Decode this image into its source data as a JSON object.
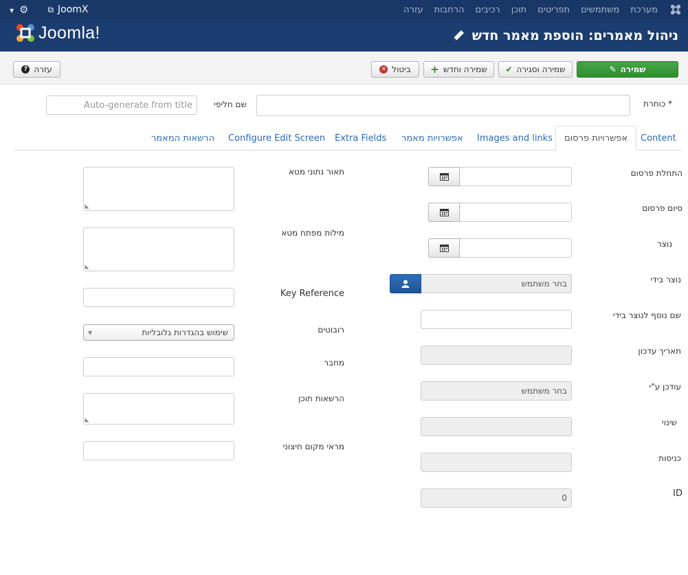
{
  "topnav": {
    "menu": [
      "מערכת",
      "משתמשים",
      "תפריטים",
      "תוכן",
      "רכיבים",
      "הרחבות",
      "עזרה"
    ],
    "site_name": "JoomX"
  },
  "header": {
    "logo_text": "Joomla!",
    "page_title": "ניהול מאמרים: הוספת מאמר חדש"
  },
  "toolbar": {
    "save": "שמירה",
    "save_close": "שמירה וסגירה",
    "save_new": "שמירה וחדש",
    "cancel": "ביטול",
    "help": "עזרה"
  },
  "title_row": {
    "title_label": "כותרת *",
    "alias_label": "שם חליפי",
    "alias_placeholder": "Auto-generate from title"
  },
  "tabs": [
    "Content",
    "אפשרויות פרסום",
    "Images and links",
    "אפשרויות מאמר",
    "Extra Fields",
    "Configure Edit Screen",
    "הרשאות המאמר"
  ],
  "publishing": {
    "publish_up": "התחלת פרסום",
    "publish_down": "סיום פרסום",
    "created": "נוצר",
    "created_by": "נוצר בידי",
    "created_by_value": "בחר משתמש",
    "created_by_alias": "שם נוסף לנוצר בידי",
    "modified": "תאריך עדכון",
    "modified_by": "עודכן ע\"י",
    "modified_by_value": "בחר משתמש",
    "revision": "שינוי",
    "hits": "כניסות",
    "id": "ID",
    "id_value": "0"
  },
  "metadata": {
    "meta_description": "תאור נתוני מטא",
    "meta_keywords": "מילות מפתח מטא",
    "key_reference": "Key Reference",
    "robots": "רובוטים",
    "robots_value": "שימוש בהגדרות גלובליות",
    "author": "מחבר",
    "content_rights": "הרשאות תוכן",
    "external_reference": "מראי מקום חיצוני"
  }
}
